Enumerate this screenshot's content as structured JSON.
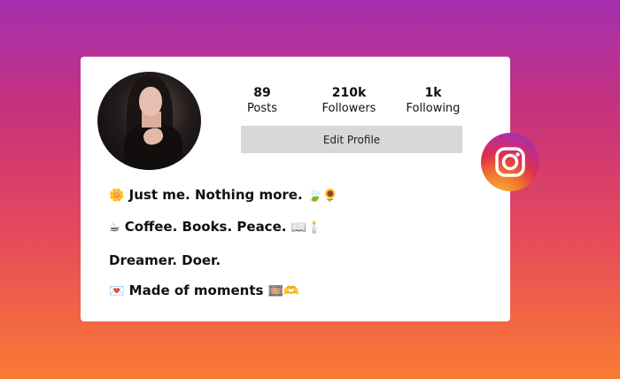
{
  "profile": {
    "stats": [
      {
        "value": "89",
        "label": "Posts"
      },
      {
        "value": "210k",
        "label": "Followers"
      },
      {
        "value": "1k",
        "label": "Following"
      }
    ],
    "edit_button": "Edit Profile"
  },
  "bio": [
    {
      "emoji_start": "🌼",
      "text": "Just me. Nothing more.",
      "emoji_end": "🍃🌻"
    },
    {
      "emoji_start": "☕",
      "text": "Coffee. Books. Peace.",
      "emoji_end": "📖🕯️"
    },
    {
      "emoji_start": "",
      "text": "Dreamer. Doer.",
      "emoji_end": ""
    },
    {
      "emoji_start": "💌",
      "text": "Made of moments",
      "emoji_end": "🎞️🫶"
    }
  ],
  "icons": {
    "brand": "instagram-icon",
    "avatar": "profile-photo"
  },
  "colors": {
    "edit_button_bg": "#d8d8d8",
    "card_bg": "#ffffff"
  }
}
